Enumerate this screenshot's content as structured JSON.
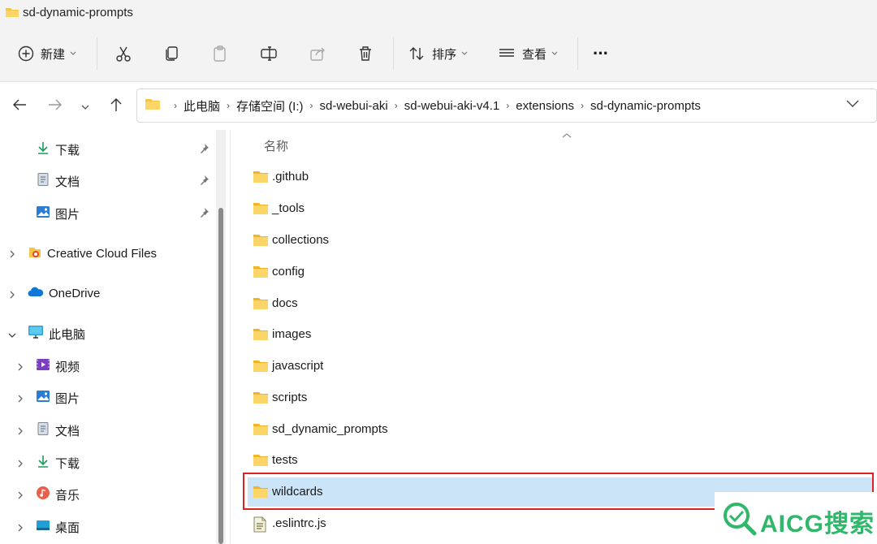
{
  "window": {
    "title": "sd-dynamic-prompts"
  },
  "toolbar": {
    "new_label": "新建",
    "sort_label": "排序",
    "view_label": "查看",
    "more_label": "···"
  },
  "address": {
    "crumbs": [
      "此电脑",
      "存储空间 (I:)",
      "sd-webui-aki",
      "sd-webui-aki-v4.1",
      "extensions",
      "sd-dynamic-prompts"
    ]
  },
  "sidebar": {
    "quick": [
      {
        "label": "下载",
        "icon": "download-icon"
      },
      {
        "label": "文档",
        "icon": "document-icon"
      },
      {
        "label": "图片",
        "icon": "picture-icon"
      }
    ],
    "roots": [
      {
        "label": "Creative Cloud Files",
        "icon": "creative-cloud-icon"
      },
      {
        "label": "OneDrive",
        "icon": "onedrive-icon"
      },
      {
        "label": "此电脑",
        "icon": "computer-icon"
      }
    ],
    "pc_children": [
      {
        "label": "视频",
        "icon": "video-icon"
      },
      {
        "label": "图片",
        "icon": "picture-icon"
      },
      {
        "label": "文档",
        "icon": "document-icon"
      },
      {
        "label": "下载",
        "icon": "download-icon"
      },
      {
        "label": "音乐",
        "icon": "music-icon"
      },
      {
        "label": "桌面",
        "icon": "desktop-icon"
      }
    ]
  },
  "list": {
    "column_name": "名称",
    "items": [
      {
        "name": ".github",
        "type": "folder"
      },
      {
        "name": "_tools",
        "type": "folder"
      },
      {
        "name": "collections",
        "type": "folder"
      },
      {
        "name": "config",
        "type": "folder"
      },
      {
        "name": "docs",
        "type": "folder"
      },
      {
        "name": "images",
        "type": "folder"
      },
      {
        "name": "javascript",
        "type": "folder"
      },
      {
        "name": "scripts",
        "type": "folder"
      },
      {
        "name": "sd_dynamic_prompts",
        "type": "folder"
      },
      {
        "name": "tests",
        "type": "folder"
      },
      {
        "name": "wildcards",
        "type": "folder",
        "selected": true
      },
      {
        "name": ".eslintrc.js",
        "type": "js-file"
      }
    ]
  },
  "watermark": {
    "text": "AICG搜索"
  },
  "colors": {
    "folder": "#f6c445",
    "selection": "#cce4f7",
    "highlight": "#e02020",
    "watermark": "#2fb86a"
  }
}
